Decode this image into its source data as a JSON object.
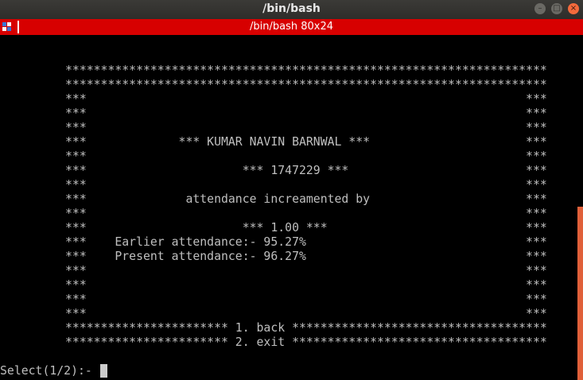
{
  "window": {
    "title": "/bin/bash",
    "tab_label": "/bin/bash 80x24",
    "buttons": [
      "–",
      "□",
      "×"
    ]
  },
  "terminal": {
    "lines": [
      "********************************************************************",
      "********************************************************************",
      "***                                                              ***",
      "***                                                              ***",
      "***                                                              ***",
      "***             *** KUMAR NAVIN BARNWAL ***                      ***",
      "***                                                              ***",
      "***                      *** 1747229 ***                         ***",
      "***                                                              ***",
      "***              attendance increamented by                      ***",
      "***                                                              ***",
      "***                      *** 1.00 ***                            ***",
      "***    Earlier attendance:- 95.27%                               ***",
      "***    Present attendance:- 96.27%                               ***",
      "***                                                              ***",
      "***                                                              ***",
      "***                                                              ***",
      "***                                                              ***",
      "*********************** 1. back ************************************",
      "*********************** 2. exit ************************************"
    ],
    "prompt": "Select(1/2):- "
  },
  "colors": {
    "titlebar": "#2e2d2a",
    "tabbar": "#d70000",
    "terminal_bg": "#000000",
    "terminal_fg": "#bfbfbf",
    "scrollbar": "#e0603a",
    "close_button": "#f46a3c"
  }
}
